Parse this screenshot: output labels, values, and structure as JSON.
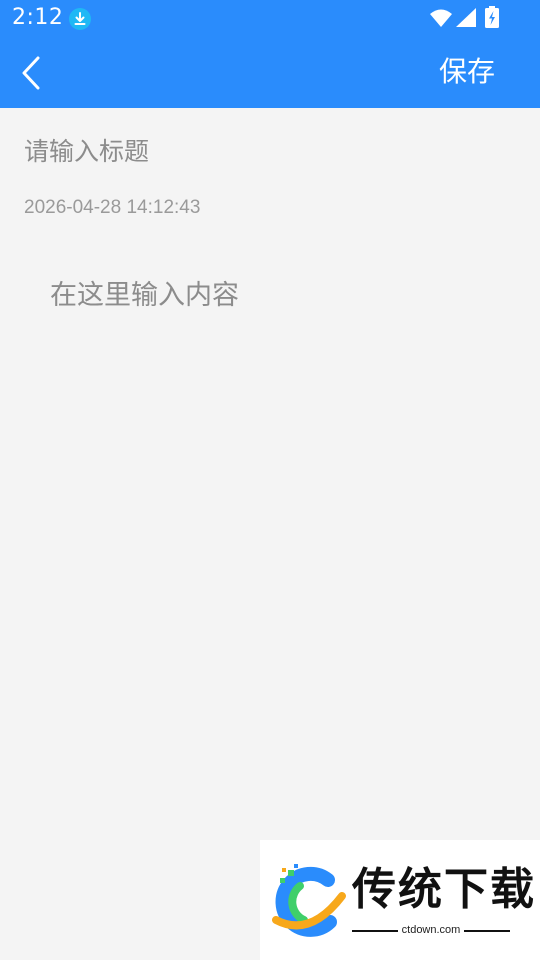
{
  "status_bar": {
    "time": "2:12",
    "icons": [
      "download-icon",
      "wifi-icon",
      "signal-icon",
      "battery-charging-icon"
    ]
  },
  "header": {
    "back_icon": "chevron-left-icon",
    "save_label": "保存"
  },
  "editor": {
    "title_placeholder": "请输入标题",
    "title_value": "",
    "timestamp": "2026-04-28 14:12:43",
    "content_placeholder": "在这里输入内容",
    "content_value": ""
  },
  "watermark": {
    "brand": "传统下载",
    "url": "ctdown.com"
  },
  "colors": {
    "header_bg": "#2a8cfc",
    "page_bg": "#f4f4f4",
    "placeholder": "#8c8c8c",
    "timestamp": "#9a9a9a",
    "download_badge": "#1fb8f5"
  }
}
